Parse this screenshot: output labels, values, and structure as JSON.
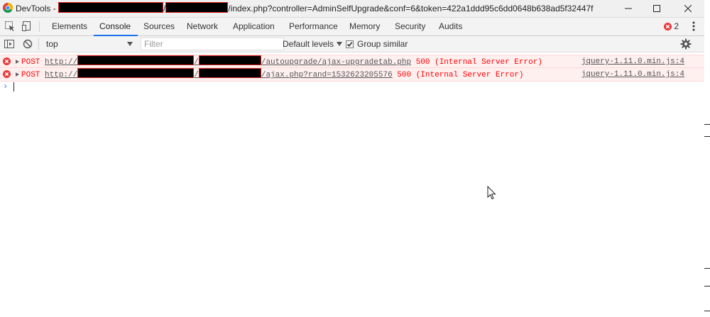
{
  "window": {
    "title_prefix": "DevTools - ",
    "title_sep": "/",
    "title_suffix": "/index.php?controller=AdminSelfUpgrade&conf=6&token=422a1ddd95c6dd0648b638ad5f32447f",
    "buttons": [
      "minimize",
      "maximize",
      "close"
    ]
  },
  "tabs": [
    "Elements",
    "Console",
    "Sources",
    "Network",
    "Application",
    "Performance",
    "Memory",
    "Security",
    "Audits"
  ],
  "active_tab": "Console",
  "error_count": "2",
  "toolbar": {
    "context": "top",
    "filter_placeholder": "Filter",
    "levels_label": "Default levels",
    "group_label": "Group similar",
    "group_checked": true
  },
  "messages": [
    {
      "method": "POST",
      "url_start": "http://",
      "url_path": "/autoupgrade/ajax-upgradetab.php",
      "status": "500 (Internal Server Error)",
      "source": "jquery-1.11.0.min.js:4"
    },
    {
      "method": "POST",
      "url_start": "http://",
      "url_path": "/ajax.php?rand=1532623205576",
      "status": "500 (Internal Server Error)",
      "source": "jquery-1.11.0.min.js:4"
    }
  ],
  "prompt_symbol": "›",
  "colors": {
    "error": "#ff0000",
    "error_bg": "#fff0f0",
    "accent": "#1a73e8",
    "redaction": "#000000",
    "redaction_border": "#e02020"
  },
  "icons": [
    "chrome-logo-icon",
    "inspect-icon",
    "device-toggle-icon",
    "sidebar-toggle-icon",
    "clear-console-icon",
    "error-icon",
    "kebab-menu-icon",
    "settings-gear-icon",
    "mouse-pointer-icon"
  ]
}
